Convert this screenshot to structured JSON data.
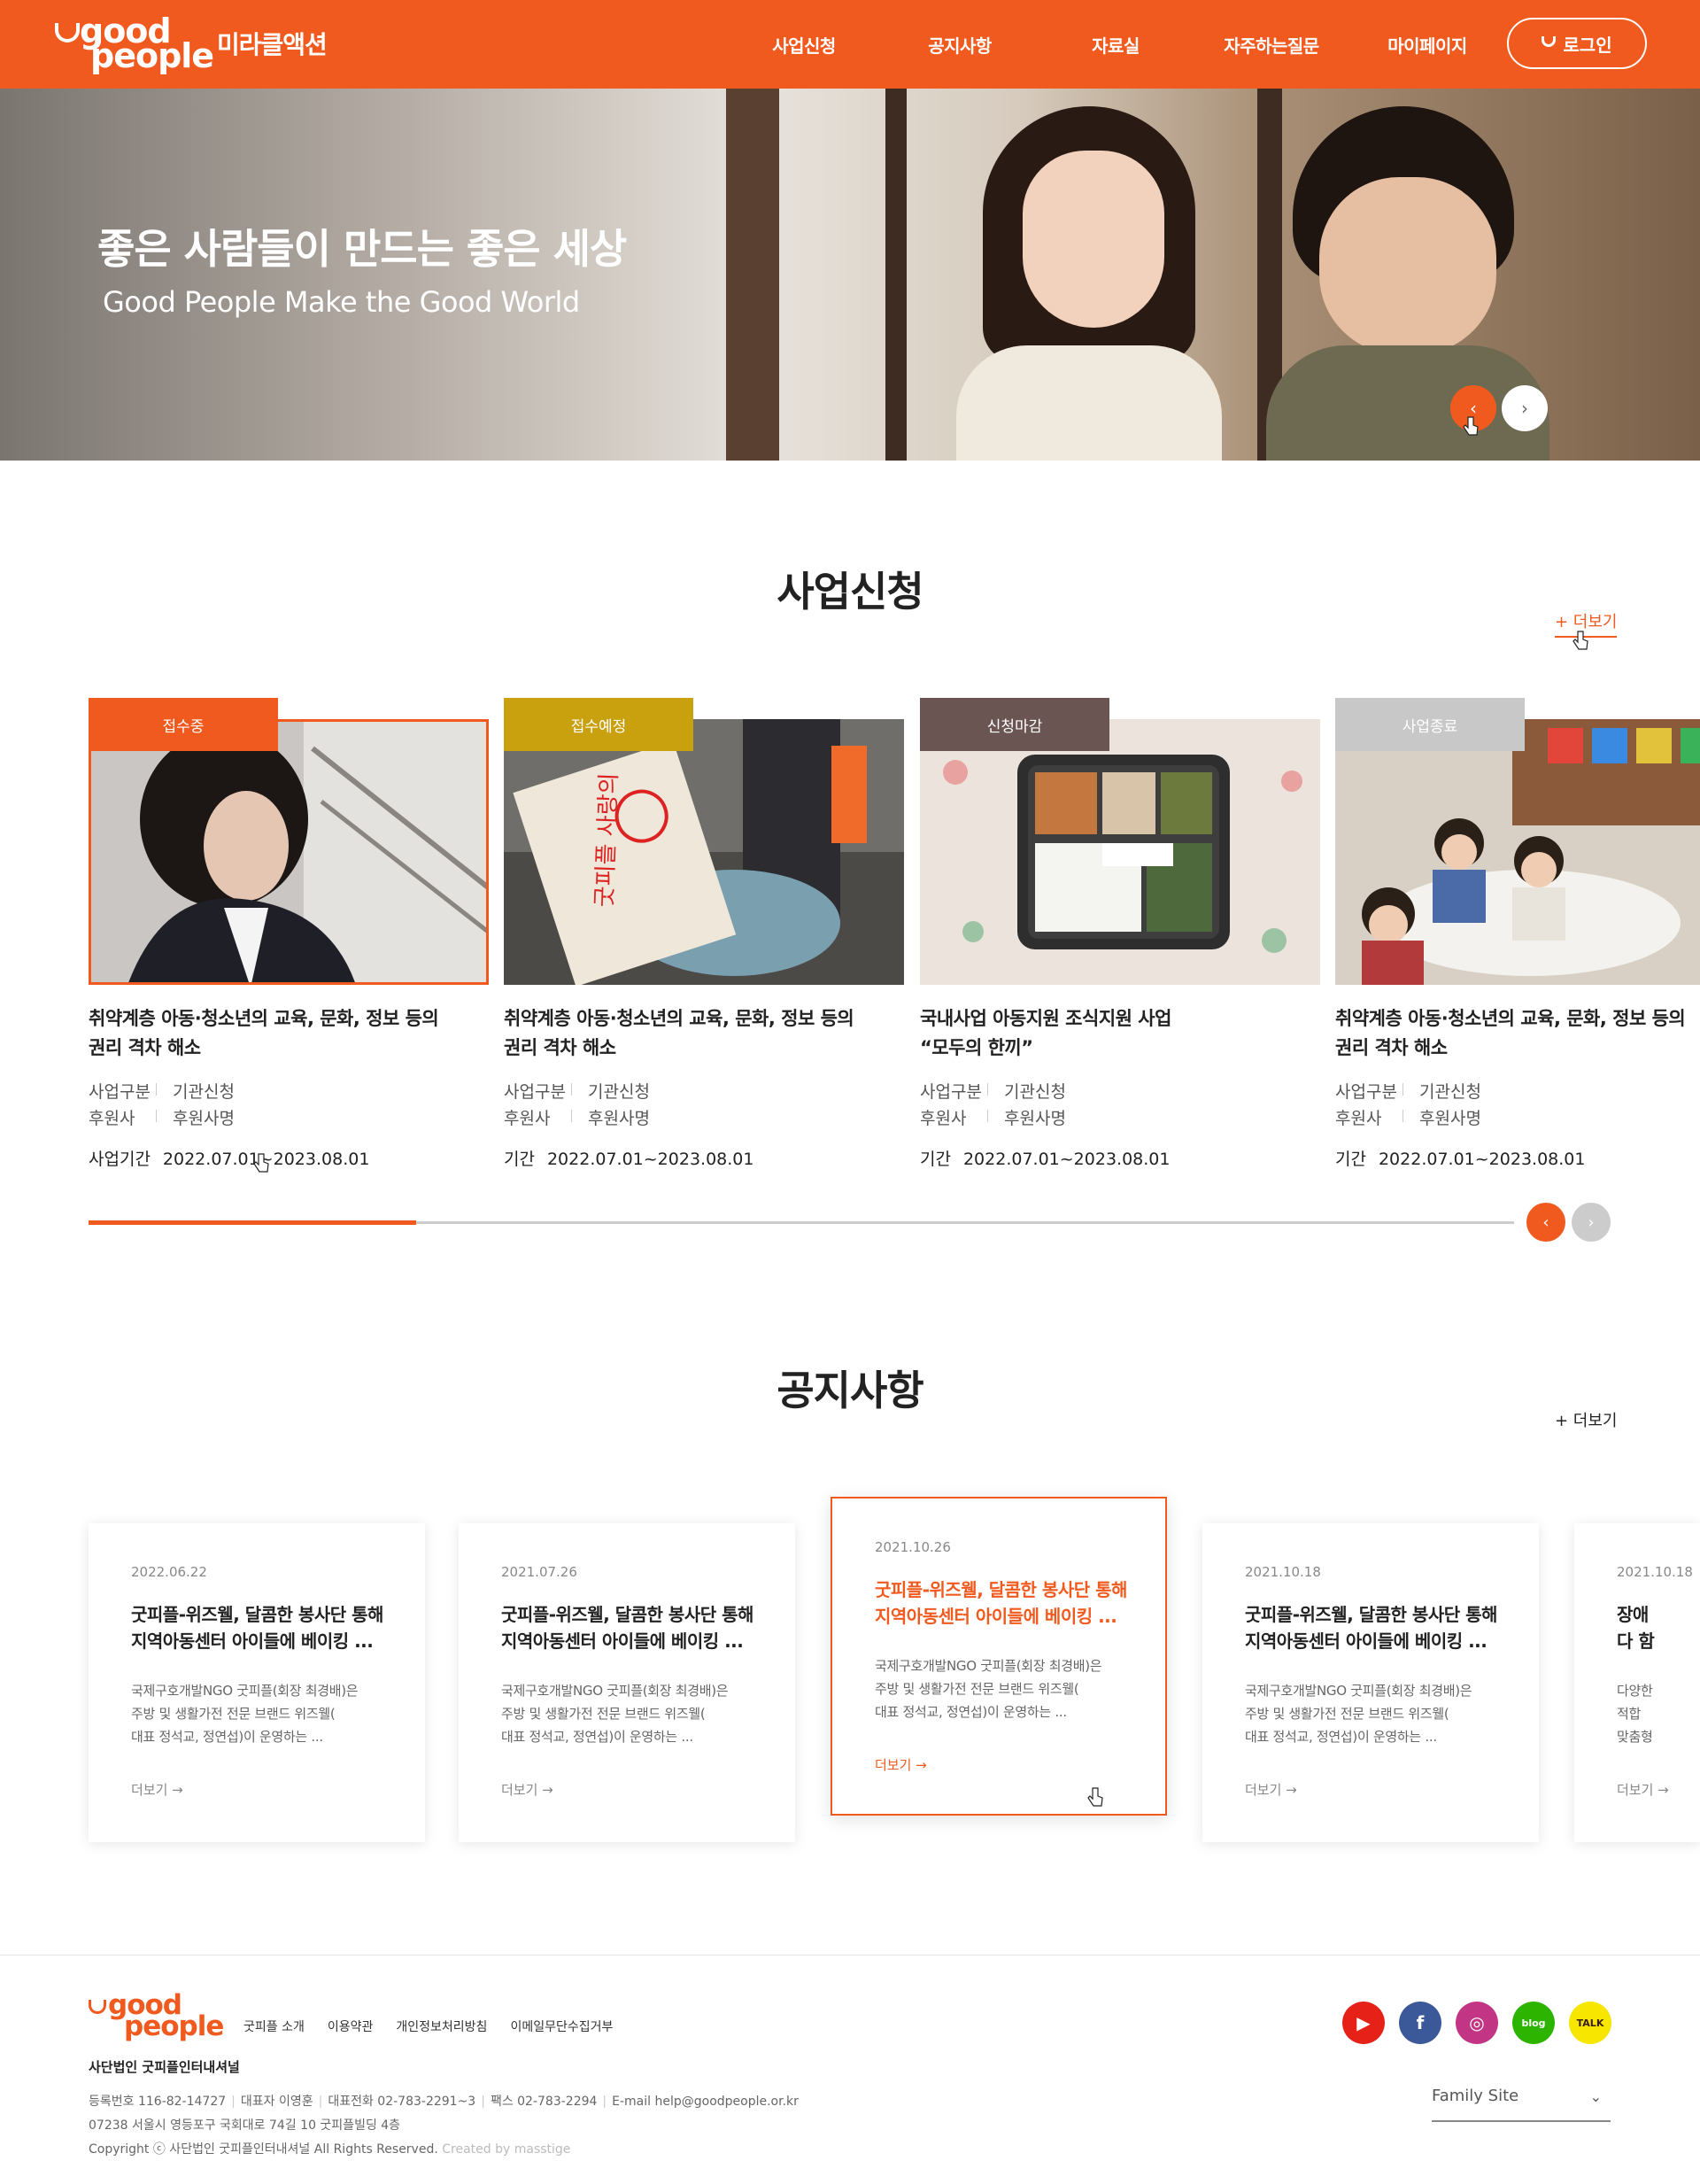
{
  "header": {
    "logo_top": "good",
    "logo_bottom": "people",
    "brand": "미라클액션",
    "nav": [
      "사업신청",
      "공지사항",
      "자료실",
      "자주하는질문",
      "마이페이지"
    ],
    "login": "로그인"
  },
  "hero": {
    "title": "좋은 사람들이 만드는 좋은 세상",
    "subtitle": "Good People Make the Good World",
    "prev_icon": "chevron-left-icon",
    "next_icon": "chevron-right-icon"
  },
  "projects": {
    "title": "사업신청",
    "more": "+ 더보기",
    "progress_fraction": 0.23,
    "cards": [
      {
        "badge": "접수중",
        "badge_color": "#f15a1e",
        "title_line1": "취약계층 아동·청소년의 교육, 문화, 정보 등의",
        "title_line2": "권리 격차 해소",
        "type_label": "사업구분",
        "type_value": "기관신청",
        "sponsor_label": "후원사",
        "sponsor_value": "후원사명",
        "period_label": "사업기간",
        "period_value": "2022.07.01~2023.08.01"
      },
      {
        "badge": "접수예정",
        "badge_color": "#c9a00e",
        "title_line1": "취약계층 아동·청소년의 교육, 문화, 정보 등의",
        "title_line2": "권리 격차 해소",
        "type_label": "사업구분",
        "type_value": "기관신청",
        "sponsor_label": "후원사",
        "sponsor_value": "후원사명",
        "period_label": "기간",
        "period_value": "2022.07.01~2023.08.01"
      },
      {
        "badge": "신청마감",
        "badge_color": "#6b5552",
        "title_line1": "국내사업 아동지원 조식지원 사업",
        "title_line2": "“모두의 한끼”",
        "type_label": "사업구분",
        "type_value": "기관신청",
        "sponsor_label": "후원사",
        "sponsor_value": "후원사명",
        "period_label": "기간",
        "period_value": "2022.07.01~2023.08.01"
      },
      {
        "badge": "사업종료",
        "badge_color": "#c8c8c8",
        "title_line1": "취약계층 아동·청소년의 교육, 문화, 정보 등의",
        "title_line2": "권리 격차 해소",
        "type_label": "사업구분",
        "type_value": "기관신청",
        "sponsor_label": "후원사",
        "sponsor_value": "후원사명",
        "period_label": "기간",
        "period_value": "2022.07.01~2023.08.01"
      }
    ]
  },
  "notices": {
    "title": "공지사항",
    "more": "+ 더보기",
    "items": [
      {
        "date": "2022.06.22",
        "title_line1": "굿피플-위즈웰, 달콤한 봉사단 통해",
        "title_line2": "지역아동센터 아이들에 베이킹 ...",
        "body_line1": "국제구호개발NGO 굿피플(회장 최경배)은",
        "body_line2": "주방 및 생활가전 전문 브랜드 위즈웰(",
        "body_line3": "대표 정석교, 정연섭)이 운영하는 ...",
        "more": "더보기 →"
      },
      {
        "date": "2021.07.26",
        "title_line1": "굿피플-위즈웰, 달콤한 봉사단 통해",
        "title_line2": "지역아동센터 아이들에 베이킹 ...",
        "body_line1": "국제구호개발NGO 굿피플(회장 최경배)은",
        "body_line2": "주방 및 생활가전 전문 브랜드 위즈웰(",
        "body_line3": "대표 정석교, 정연섭)이 운영하는 ...",
        "more": "더보기 →"
      },
      {
        "date": "2021.10.26",
        "title_line1": "굿피플-위즈웰, 달콤한 봉사단 통해",
        "title_line2": "지역아동센터 아이들에 베이킹 ...",
        "body_line1": "국제구호개발NGO 굿피플(회장 최경배)은",
        "body_line2": "주방 및 생활가전 전문 브랜드 위즈웰(",
        "body_line3": "대표 정석교, 정연섭)이 운영하는 ...",
        "more": "더보기 →"
      },
      {
        "date": "2021.10.18",
        "title_line1": "굿피플-위즈웰, 달콤한 봉사단 통해",
        "title_line2": "지역아동센터 아이들에 베이킹 ...",
        "body_line1": "국제구호개발NGO 굿피플(회장 최경배)은",
        "body_line2": "주방 및 생활가전 전문 브랜드 위즈웰(",
        "body_line3": "대표 정석교, 정연섭)이 운영하는 ...",
        "more": "더보기 →"
      },
      {
        "date": "2021.10.18",
        "title_line1": "장애",
        "title_line2": "다 함",
        "body_line1": "다양한",
        "body_line2": "적합",
        "body_line3": "맞춤형",
        "more": "더보기 →"
      }
    ]
  },
  "footer": {
    "logo_top": "good",
    "logo_bottom": "people",
    "links": [
      "굿피플 소개",
      "이용약관",
      "개인정보처리방침",
      "이메일무단수집거부"
    ],
    "org": "사단법인 굿피플인터내셔널",
    "reg": "등록번호 116-82-14727",
    "ceo": "대표자 이영훈",
    "tel": "대표전화 02-783-2291~3",
    "fax": "팩스 02-783-2294",
    "email": "E-mail help@goodpeople.or.kr",
    "address": "07238 서울시 영등포구 국회대로 74길 10 굿피플빌딩 4층",
    "copyright": "Copyright ⓒ 사단법인 굿피플인터내셔널 All Rights Reserved.",
    "credit": "Created by masstige",
    "family_site": "Family Site",
    "social": [
      {
        "name": "youtube-icon",
        "color": "#e62117",
        "glyph": "▶"
      },
      {
        "name": "facebook-icon",
        "color": "#3b5998",
        "glyph": "f"
      },
      {
        "name": "instagram-icon",
        "color": "#c13584",
        "glyph": "◎"
      },
      {
        "name": "blog-icon",
        "color": "#2db400",
        "glyph": "blog"
      },
      {
        "name": "kakaotalk-icon",
        "color": "#f7e600",
        "glyph": "TALK"
      }
    ]
  }
}
